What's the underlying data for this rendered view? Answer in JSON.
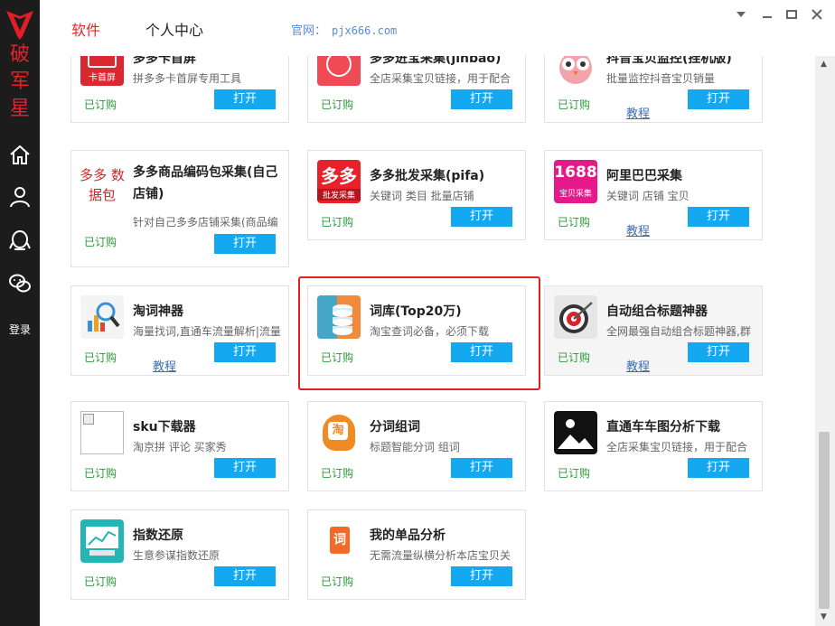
{
  "sidebar": {
    "brand": [
      "破",
      "军",
      "星"
    ],
    "login": "登录"
  },
  "topbar": {
    "tabs": [
      "软件",
      "个人中心"
    ],
    "site_label": "官网：",
    "site_url": "pjx666.com"
  },
  "common": {
    "subscribed": "已订购",
    "open": "打开",
    "tutorial": "教程"
  },
  "cards": [
    {
      "name": "多多卡首屏",
      "desc": "拼多多卡首屏专用工具",
      "icon_text": "卡首屏",
      "icon": "red-stamp-icon",
      "tutorial": false
    },
    {
      "name": "多多进宝采集(jinbao)",
      "desc": "全店采集宝贝链接，用于配合",
      "icon": "red-seal-icon",
      "tutorial": false
    },
    {
      "name": "抖音宝贝监控(挂机版)",
      "desc": "批量监控抖音宝贝销量",
      "icon": "owl-icon",
      "tutorial": true
    },
    {
      "name": "多多商品编码包采集(自己店铺)",
      "desc": "针对自己多多店铺采集(商品编",
      "icon_text": "多多 数据包",
      "icon": "text-icon",
      "tutorial": false
    },
    {
      "name": "多多批发采集(pifa)",
      "desc": "关键词 类目 批量店铺",
      "icon_text": "多多",
      "icon_sub": "批发采集",
      "icon": "red-badge-icon",
      "tutorial": false
    },
    {
      "name": "阿里巴巴采集",
      "desc": "关键词 店铺 宝贝",
      "icon_text": "1688",
      "icon_sub": "宝贝采集",
      "icon": "magenta-badge-icon",
      "tutorial": true
    },
    {
      "name": "淘词神器",
      "desc": "海量找词,直通车流量解析|流量",
      "icon": "magnifier-chart-icon",
      "tutorial": true
    },
    {
      "name": "词库(Top20万)",
      "desc": "淘宝查词必备，必须下载",
      "icon": "database-icon",
      "tutorial": false
    },
    {
      "name": "自动组合标题神器",
      "desc": "全网最强自动组合标题神器,群",
      "icon": "target-icon",
      "tutorial": true
    },
    {
      "name": "sku下载器",
      "desc": "淘京拼 评论 买家秀",
      "icon": "broken-image-icon",
      "tutorial": false
    },
    {
      "name": "分词组词",
      "desc": "标题智能分词 组词",
      "icon_text": "淘",
      "icon": "head-icon",
      "tutorial": false
    },
    {
      "name": "直通车车图分析下载",
      "desc": "全店采集宝贝链接，用于配合",
      "icon": "image-icon",
      "tutorial": false
    },
    {
      "name": "指数还原",
      "desc": "生意参谋指数还原",
      "icon": "monitor-chart-icon",
      "tutorial": false
    },
    {
      "name": "我的单品分析",
      "desc": "无需流量纵横分析本店宝贝关",
      "icon_text": "词",
      "icon": "tag-icon",
      "tutorial": false
    }
  ]
}
